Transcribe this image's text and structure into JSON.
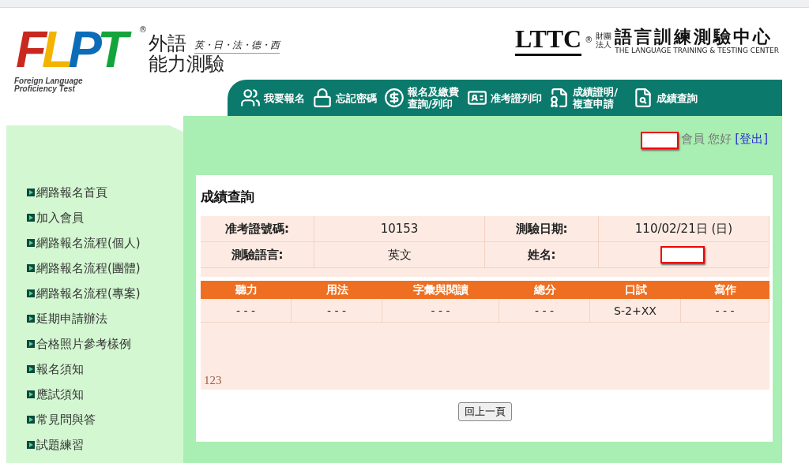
{
  "header": {
    "logo": {
      "letters": [
        {
          "text": "F",
          "color": "#c8281e"
        },
        {
          "text": "L",
          "color": "#f2b400"
        },
        {
          "text": "P",
          "color": "#0b6db7"
        },
        {
          "text": "T",
          "color": "#14a43c"
        }
      ],
      "registered": "®",
      "title_line_1": "外語",
      "title_line_2": "能力測驗",
      "languages": "英・日・法・德・西",
      "subtitle_line_1": "Foreign Language",
      "subtitle_line_2": "Proficiency Test"
    },
    "partner_logo": {
      "mark": "LTTC",
      "registered": "®",
      "org_type": "財團法人",
      "name": "語言訓練測驗中心",
      "english_name": "THE LANGUAGE TRAINING & TESTING CENTER"
    }
  },
  "nav": [
    {
      "label": "我要報名"
    },
    {
      "label": "忘記密碼"
    },
    {
      "label": "報名及繳費查詢/列印"
    },
    {
      "label": "准考證列印"
    },
    {
      "label": "成績證明/複查申請"
    },
    {
      "label": "成績查詢"
    }
  ],
  "sidebar": {
    "items": [
      "網路報名首頁",
      "加入會員",
      "網路報名流程(個人)",
      "網路報名流程(團體)",
      "網路報名流程(專案)",
      "延期申請辦法",
      "合格照片參考樣例",
      "報名須知",
      "應試須知",
      "常見問與答",
      "試題練習"
    ]
  },
  "user_bar": {
    "greeting": "會員 您好",
    "logout": "[登出]"
  },
  "result": {
    "title": "成績查詢",
    "info": [
      [
        {
          "label": "准考證號碼:",
          "value": "10153"
        },
        {
          "label": "測驗日期:",
          "value": "110/02/21日 (日)"
        }
      ],
      [
        {
          "label": "測驗語言:",
          "value": "英文"
        },
        {
          "label": "姓名:",
          "redacted": true
        }
      ]
    ],
    "columns": [
      "聽力",
      "用法",
      "字彙與閱讀",
      "總分",
      "口試",
      "寫作"
    ],
    "rows": [
      [
        "- - -",
        "- - -",
        "- - -",
        "- - -",
        "S-2+XX",
        "- - -"
      ]
    ],
    "note": "123",
    "back_button": "回上一頁"
  }
}
